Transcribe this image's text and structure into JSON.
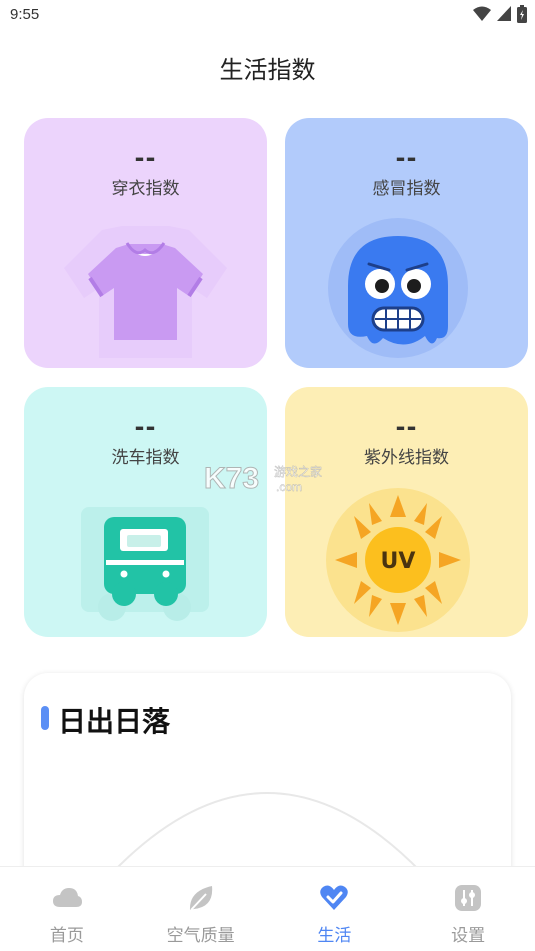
{
  "status_bar": {
    "time": "9:55",
    "icons": [
      "wifi-icon",
      "signal-icon",
      "battery-icon"
    ]
  },
  "page_title": "生活指数",
  "index_cards": [
    {
      "id": "dressing",
      "value": "--",
      "label": "穿衣指数",
      "color": "#ecd4fc",
      "icon": "tshirt-icon"
    },
    {
      "id": "cold",
      "value": "--",
      "label": "感冒指数",
      "color": "#b2cbfb",
      "icon": "cold-face-icon"
    },
    {
      "id": "carwash",
      "value": "--",
      "label": "洗车指数",
      "color": "#cdf7f4",
      "icon": "car-icon"
    },
    {
      "id": "uv",
      "value": "--",
      "label": "紫外线指数",
      "color": "#fdeeb5",
      "icon": "uv-sun-icon",
      "icon_text": "UV"
    }
  ],
  "sunrise_sunset": {
    "title": "日出日落",
    "accent_color": "#5b8ff5"
  },
  "watermark": {
    "logo": "K73",
    "text": "游戏之家",
    "domain": ".com"
  },
  "tabbar": {
    "items": [
      {
        "label": "首页",
        "icon": "cloud-icon",
        "active": false
      },
      {
        "label": "空气质量",
        "icon": "leaf-icon",
        "active": false
      },
      {
        "label": "生活",
        "icon": "heart-check-icon",
        "active": true
      },
      {
        "label": "设置",
        "icon": "sliders-icon",
        "active": false
      }
    ],
    "active_color": "#4f86f3",
    "inactive_color": "#9a9a9a"
  }
}
